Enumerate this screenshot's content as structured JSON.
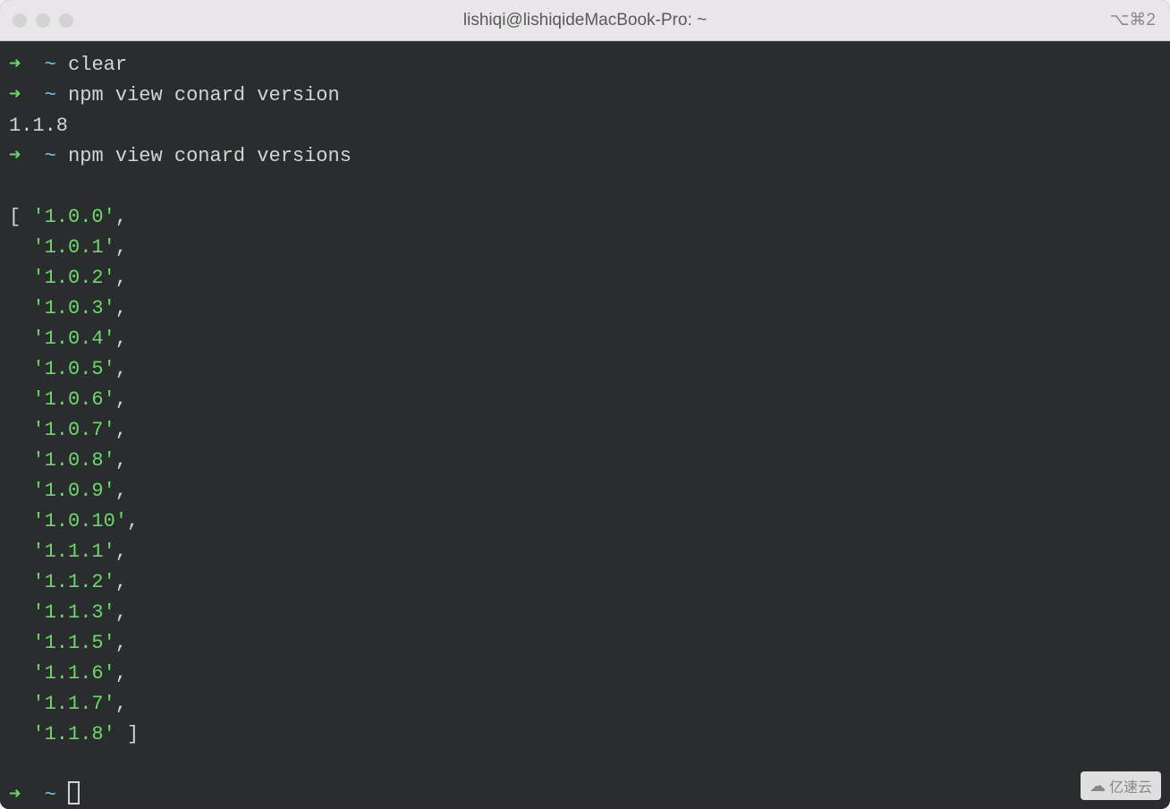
{
  "window": {
    "title": "lishiqi@lishiqideMacBook-Pro: ~",
    "shortcut": "⌥⌘2"
  },
  "prompt": {
    "arrow": "➜",
    "path": "~"
  },
  "commands": {
    "cmd1": "clear",
    "cmd2": "npm view conard version",
    "cmd3": "npm view conard versions"
  },
  "output1": "1.1.8",
  "versions": [
    "1.0.0",
    "1.0.1",
    "1.0.2",
    "1.0.3",
    "1.0.4",
    "1.0.5",
    "1.0.6",
    "1.0.7",
    "1.0.8",
    "1.0.9",
    "1.0.10",
    "1.1.1",
    "1.1.2",
    "1.1.3",
    "1.1.5",
    "1.1.6",
    "1.1.7",
    "1.1.8"
  ],
  "watermark": "亿速云"
}
